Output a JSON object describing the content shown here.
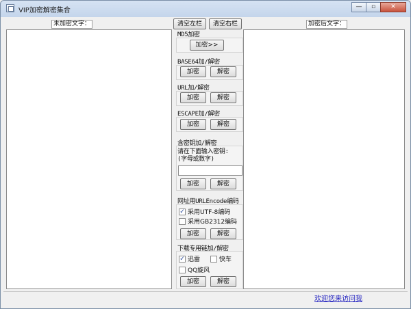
{
  "window": {
    "title": "VIP加密解密集合",
    "minimize_glyph": "—",
    "maximize_glyph": "▫",
    "close_glyph": "✕"
  },
  "left": {
    "label": "未加密文字："
  },
  "right": {
    "label": "加密后文字："
  },
  "toolbar": {
    "clear_left": "清空左栏",
    "clear_right": "清空右栏"
  },
  "groups": {
    "md5": {
      "title": "MD5加密",
      "encrypt": "加密>>"
    },
    "base64": {
      "title": "BASE64加/解密",
      "encrypt": "加密",
      "decrypt": "解密"
    },
    "url": {
      "title": "URL加/解密",
      "encrypt": "加密",
      "decrypt": "解密"
    },
    "escape": {
      "title": "ESCAPE加/解密",
      "encrypt": "加密",
      "decrypt": "解密"
    },
    "key": {
      "title": "含密钥加/解密",
      "prompt_line1": "请在下面输入密钥:",
      "prompt_line2": "(字母或数字)",
      "input_value": "",
      "encrypt": "加密",
      "decrypt": "解密"
    },
    "urlencode": {
      "title": "网址用URLEncode编码",
      "opt_utf8": "采用UTF-8编码",
      "opt_gb2312": "采用GB2312编码",
      "encrypt": "加密",
      "decrypt": "解密"
    },
    "download": {
      "title": "下载专用链加/解密",
      "opt_xunlei": "迅雷",
      "opt_kuaiche": "快车",
      "opt_qq": "QQ旋风",
      "encrypt": "加密",
      "decrypt": "解密"
    }
  },
  "status": {
    "link": "欢迎您来访问我"
  }
}
